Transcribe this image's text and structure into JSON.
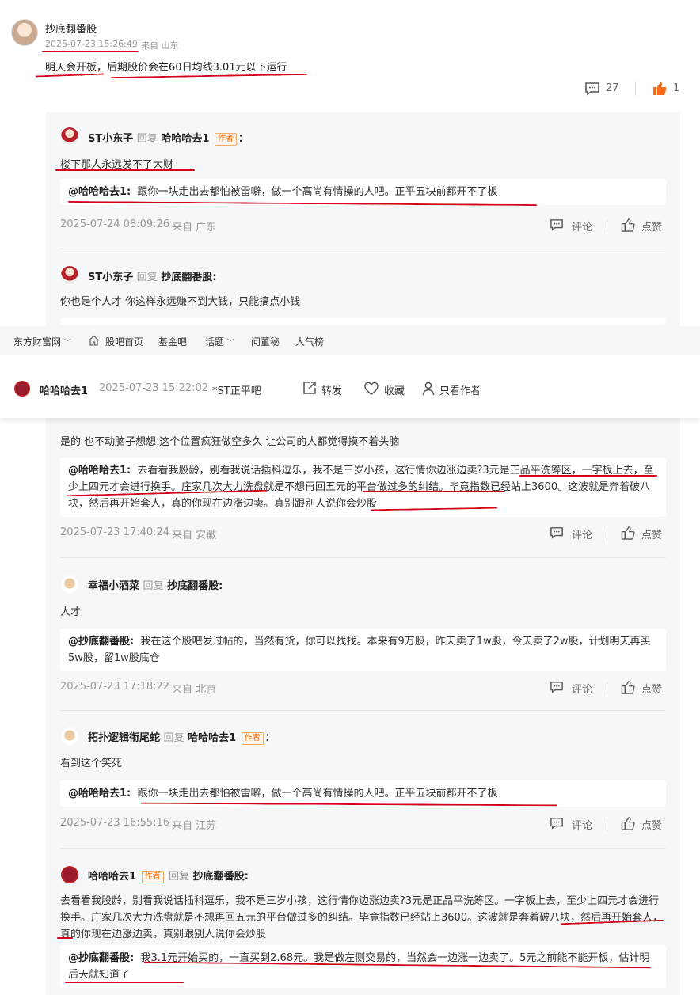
{
  "top": {
    "username": "抄底翻番股",
    "time": "2025-07-23 15:26:49",
    "location": "来自 山东",
    "text_a": "明天会开板",
    "text_b": "，",
    "text_c": "后期股价会在60日均线3.01元以下运行",
    "comment_count": "27",
    "like_count": "1"
  },
  "replies": [
    {
      "user": "ST小东子",
      "reply_word": "回复",
      "target": "哈哈哈去1",
      "author_tag": "作者",
      "colon": "：",
      "text": "楼下那人永远发不了大财",
      "quote_user": "@哈哈哈去1:",
      "quote_text": "跟你一块走出去都怕被雷噼，做一个高尚有情操的人吧。正平五块前都开不了板",
      "time": "2025-07-24 08:09:26",
      "location": "来自 广东",
      "comment_label": "评论",
      "like_label": "点赞"
    },
    {
      "user": "ST小东子",
      "reply_word": "回复",
      "target": "抄底翻番股:",
      "text": "你也是个人才 你这样永远赚不到大钱，只能搞点小钱"
    },
    {
      "text": "是的 也不动脑子想想 这个位置疯狂做空多久 让公司的人都觉得摸不着头脑",
      "quote_user": "@哈哈哈去1:",
      "quote_text": "去看看我股龄，别看我说话插科逗乐，我不是三岁小孩，这行情你边涨边卖?3元是正品平洗筹区，一字板上去，至少上四元才会进行换手。庄家几次大力洗盘就是不想再回五元的平台做过多的纠结。毕竟指数已经站上3600。这波就是奔着破八块，然后再开始套人，真的你现在边涨边卖。真别跟别人说你会炒股",
      "time": "2025-07-23 17:40:24",
      "location": "来自 安徽",
      "comment_label": "评论",
      "like_label": "点赞"
    },
    {
      "user": "幸福小酒菜",
      "reply_word": "回复",
      "target": "抄底翻番股:",
      "text": "人才",
      "quote_user": "@抄底翻番股:",
      "quote_text": "我在这个股吧发过帖的，当然有货，你可以找找。本来有9万股，昨天卖了1w股，今天卖了2w股，计划明天再买5w股，留1w股底仓",
      "time": "2025-07-23 17:18:22",
      "location": "来自 北京",
      "comment_label": "评论",
      "like_label": "点赞"
    },
    {
      "user": "拓扑逻辑衔尾蛇",
      "reply_word": "回复",
      "target": "哈哈哈去1",
      "author_tag": "作者",
      "colon": "：",
      "text": "看到这个笑死",
      "quote_user": "@哈哈哈去1:",
      "quote_text": "跟你一块走出去都怕被雷噼，做一个高尚有情操的人吧。正平五块前都开不了板",
      "time": "2025-07-23 16:55:16",
      "location": "来自 江苏",
      "comment_label": "评论",
      "like_label": "点赞"
    },
    {
      "user": "哈哈哈去1",
      "author_tag": "作者",
      "reply_word": "回复",
      "target": "抄底翻番股:",
      "text": "去看看我股龄，别看我说话插科逗乐，我不是三岁小孩，这行情你边涨边卖?3元是正品平洗筹区。一字板上去，至少上四元才会进行换手。庄家几次大力洗盘就是不想再回五元的平台做过多的纠结。毕竟指数已经站上3600。这波就是奔着破八块，然后再开始套人，真的你现在边涨边卖。真别跟别人说你会炒股",
      "quote_user": "@抄底翻番股:",
      "quote_text": "我3.1元开始买的，一直买到2.68元。我是做左侧交易的，当然会一边涨一边卖了。5元之前能不能开板，估计明后天就知道了"
    }
  ],
  "navbar": {
    "items": [
      "东方财富网",
      "股吧首页",
      "基金吧",
      "话题",
      "问董秘",
      "人气榜"
    ]
  },
  "post": {
    "author": "哈哈哈去1",
    "time": "2025-07-23 15:22:02",
    "bar": "*ST正平吧",
    "forward": "转发",
    "collect": "收藏",
    "only_author": "只看作者"
  },
  "colors": {
    "underline": "#d0021b",
    "like_orange": "#f66a1a",
    "author_tag": "#ff6600"
  },
  "icons": [
    "comment-icon",
    "thumb-up-icon",
    "home-icon",
    "chevron-down-icon",
    "share-icon",
    "heart-icon",
    "person-icon"
  ]
}
